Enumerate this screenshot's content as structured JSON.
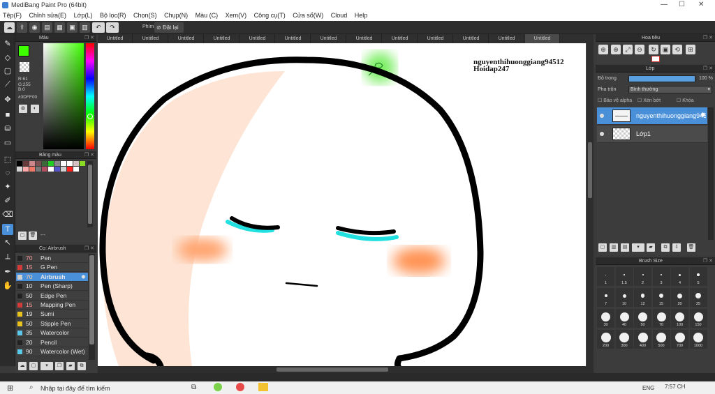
{
  "window": {
    "title": "MediBang Paint Pro (64bit)",
    "minimize": "—",
    "maximize": "☐",
    "close": "✕"
  },
  "menu": [
    "Tệp(F)",
    "Chỉnh sửa(E)",
    "Lớp(L)",
    "Bộ lọc(R)",
    "Chọn(S)",
    "Chụp(N)",
    "Màu (C)",
    "Xem(V)",
    "Công cụ(T)",
    "Cửa sổ(W)",
    "Cloud",
    "Help"
  ],
  "toolbar": {
    "phim_label": "Phím",
    "reset_label": "Đặt lại"
  },
  "color_panel": {
    "title": "Màu",
    "r": "R:61",
    "g": "G:255",
    "b": "B:0",
    "hex": "#3DFF00",
    "fg_color": "#3dff00"
  },
  "swatch_panel": {
    "title": "Bảng màu",
    "add_label": "---",
    "colors": [
      "#000000",
      "#6a3a3a",
      "#cc8888",
      "#7a5050",
      "#3a6a3a",
      "#22cc22",
      "#888888",
      "#ffffff",
      "#ffffff",
      "#d4c0c0",
      "#88dd22",
      "#d6d6d6",
      "#ffaaaa",
      "#ee7766",
      "#777777",
      "#b05060",
      "#ffffff",
      "#5555cc",
      "#cfcfcf",
      "#ff2222",
      "#ffffff"
    ]
  },
  "brush_panel": {
    "title": "Cọ: Airbrush",
    "brushes": [
      {
        "size": "70",
        "name": "Pen",
        "color": "#222222"
      },
      {
        "size": "15",
        "name": "G Pen",
        "color": "#d23a3a"
      },
      {
        "size": "70",
        "name": "Airbrush",
        "color": "#cfcfcf"
      },
      {
        "size": "10",
        "name": "Pen (Sharp)",
        "color": "#222222"
      },
      {
        "size": "50",
        "name": "Edge Pen",
        "color": "#222222"
      },
      {
        "size": "15",
        "name": "Mapping Pen",
        "color": "#d23a3a"
      },
      {
        "size": "19",
        "name": "Sumi",
        "color": "#e8c21e"
      },
      {
        "size": "50",
        "name": "Stipple Pen",
        "color": "#e8c21e"
      },
      {
        "size": "35",
        "name": "Watercolor",
        "color": "#5bc8e8"
      },
      {
        "size": "20",
        "name": "Pencil",
        "color": "#222222"
      },
      {
        "size": "90",
        "name": "Watercolor (Wet)",
        "color": "#5bc8e8"
      }
    ]
  },
  "tabs": [
    "Untitled",
    "Untitled",
    "Untitled",
    "Untitled",
    "Untitled",
    "Untitled",
    "Untitled",
    "Untitled",
    "Untitled",
    "Untitled",
    "Untitled",
    "Untitled",
    "Untitled"
  ],
  "canvas": {
    "text_line1": "nguyenthihuonggiang94512",
    "text_line2": "Hoidap247"
  },
  "navigator_panel": {
    "title": "Hoa tiêu"
  },
  "layer_panel": {
    "title": "Lớp",
    "opacity_label": "Độ trong",
    "opacity_value": "100 %",
    "blend_label": "Pha trộn",
    "blend_value": "Bình thường",
    "protect_alpha": "Bảo vệ alpha",
    "clipping": "Xén bớt",
    "lock": "Khóa",
    "layers": [
      {
        "name": "nguyenthihuonggiang94512"
      },
      {
        "name": "Lớp1"
      }
    ]
  },
  "brushsize_panel": {
    "title": "Brush Size",
    "sizes": [
      "1",
      "1.5",
      "2",
      "3",
      "4",
      "5",
      "7",
      "10",
      "12",
      "15",
      "20",
      "25",
      "30",
      "40",
      "50",
      "70",
      "100",
      "150",
      "200",
      "300",
      "400",
      "500",
      "700",
      "1000"
    ]
  },
  "taskbar": {
    "search_placeholder": "Nhập tại đây để tìm kiếm",
    "lang": "ENG",
    "time": "7:57 CH"
  }
}
